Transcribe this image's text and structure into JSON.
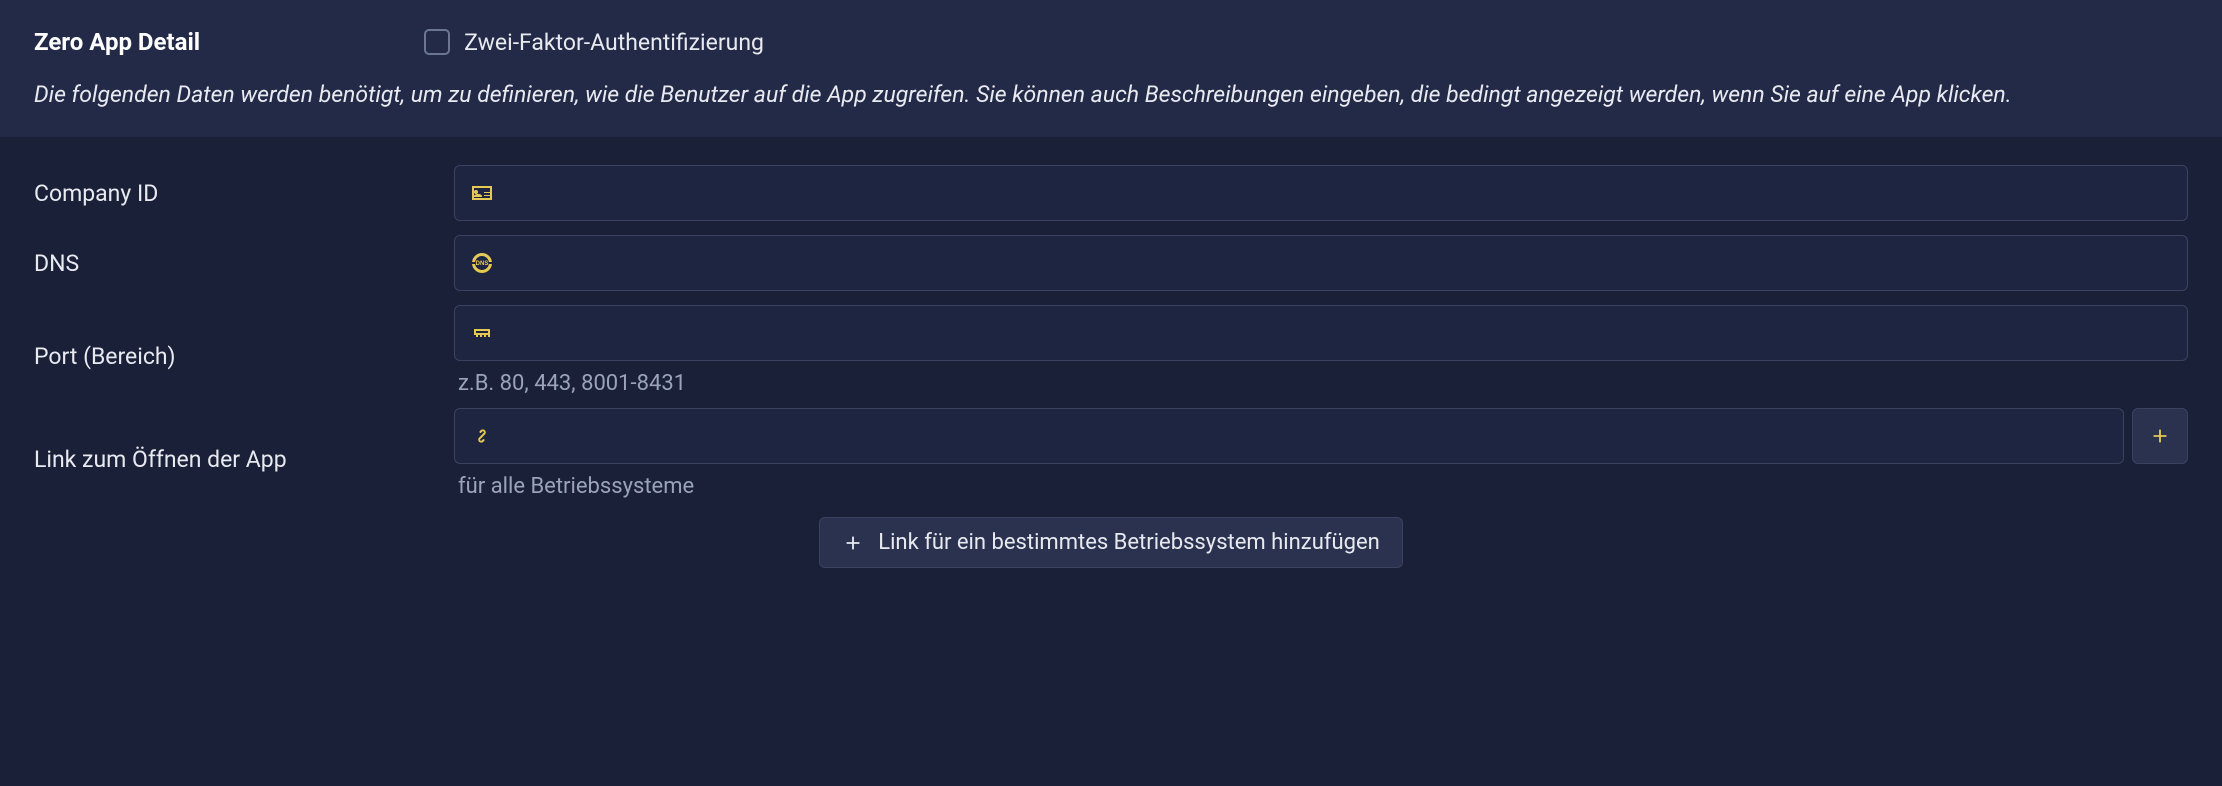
{
  "header": {
    "title": "Zero App Detail",
    "twofa_label": "Zwei-Faktor-Authentifizierung",
    "description": "Die folgenden Daten werden benötigt, um zu definieren, wie die Benutzer auf die App zugreifen. Sie können auch Beschreibungen eingeben, die bedingt angezeigt werden, wenn Sie auf eine App klicken."
  },
  "form": {
    "company_id": {
      "label": "Company ID",
      "value": ""
    },
    "dns": {
      "label": "DNS",
      "value": ""
    },
    "port": {
      "label": "Port (Bereich)",
      "value": "",
      "hint": "z.B. 80, 443, 8001-8431"
    },
    "open_link": {
      "label": "Link zum Öffnen der App",
      "value": "",
      "hint": "für alle Betriebssysteme"
    },
    "add_os_button": "Link für ein bestimmtes Betriebssystem hinzufügen"
  }
}
